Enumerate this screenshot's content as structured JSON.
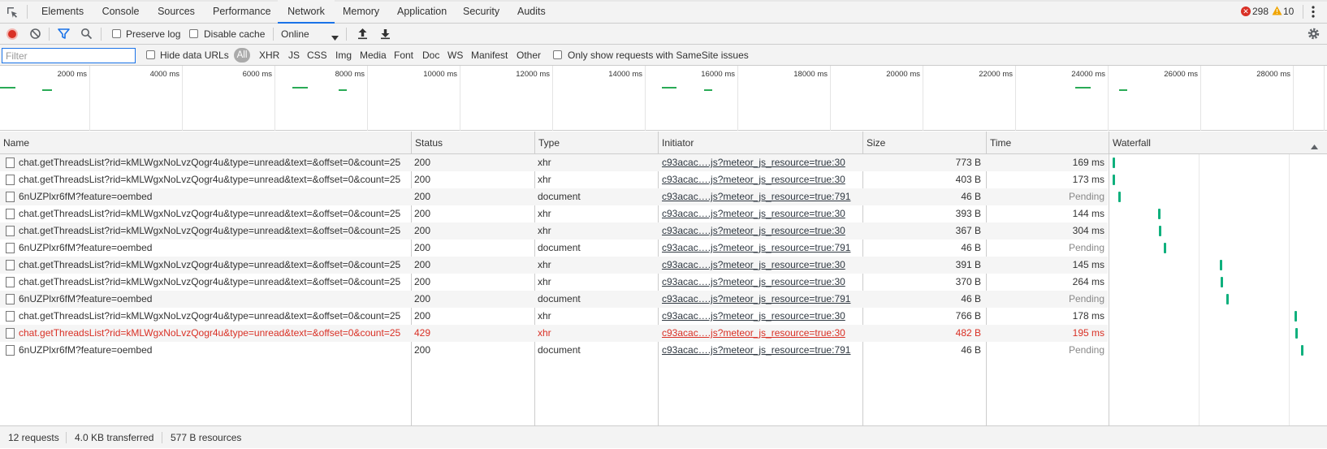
{
  "tabs": [
    {
      "label": "Elements",
      "active": false
    },
    {
      "label": "Console",
      "active": false
    },
    {
      "label": "Sources",
      "active": false
    },
    {
      "label": "Performance",
      "active": false
    },
    {
      "label": "Network",
      "active": true
    },
    {
      "label": "Memory",
      "active": false
    },
    {
      "label": "Application",
      "active": false
    },
    {
      "label": "Security",
      "active": false
    },
    {
      "label": "Audits",
      "active": false
    }
  ],
  "badges": {
    "errors": "298",
    "warnings": "10"
  },
  "icons": {
    "inspect": "inspect-element-icon",
    "device": "device-toolbar-icon",
    "record": "record-icon",
    "clear": "clear-icon",
    "filter": "filter-icon",
    "search": "search-icon",
    "upload": "import-har-icon",
    "download": "export-har-icon",
    "settings": "gear-icon",
    "more": "more-vertical-icon",
    "error": "error-icon",
    "warning": "warning-icon",
    "sort": "sort-ascending-icon",
    "file": "document-file-icon"
  },
  "toolbar": {
    "preserve_log": "Preserve log",
    "disable_cache": "Disable cache",
    "throttling": "Online"
  },
  "filter": {
    "placeholder": "Filter",
    "hide_data_urls": "Hide data URLs",
    "types": [
      "All",
      "XHR",
      "JS",
      "CSS",
      "Img",
      "Media",
      "Font",
      "Doc",
      "WS",
      "Manifest",
      "Other"
    ],
    "samesite": "Only show requests with SameSite issues"
  },
  "overview": {
    "ticks": [
      "2000 ms",
      "4000 ms",
      "6000 ms",
      "8000 ms",
      "10000 ms",
      "12000 ms",
      "14000 ms",
      "16000 ms",
      "18000 ms",
      "20000 ms",
      "22000 ms",
      "24000 ms",
      "26000 ms",
      "28000 ms"
    ]
  },
  "columns": {
    "name": "Name",
    "status": "Status",
    "type": "Type",
    "initiator": "Initiator",
    "size": "Size",
    "time": "Time",
    "waterfall": "Waterfall"
  },
  "requests": [
    {
      "name": "chat.getThreadsList?rid=kMLWgxNoLvzQogr4u&type=unread&text=&offset=0&count=25",
      "status": "200",
      "type": "xhr",
      "initiator": "c93acac….js?meteor_js_resource=true:30",
      "size": "773 B",
      "time": "169 ms",
      "wf_start_ms": 200,
      "error": false,
      "pending": false
    },
    {
      "name": "chat.getThreadsList?rid=kMLWgxNoLvzQogr4u&type=unread&text=&offset=0&count=25",
      "status": "200",
      "type": "xhr",
      "initiator": "c93acac….js?meteor_js_resource=true:30",
      "size": "403 B",
      "time": "173 ms",
      "wf_start_ms": 250,
      "error": false,
      "pending": false
    },
    {
      "name": "6nUZPlxr6fM?feature=oembed",
      "status": "200",
      "type": "document",
      "initiator": "c93acac….js?meteor_js_resource=true:791",
      "size": "46 B",
      "time": "Pending",
      "wf_start_ms": 1000,
      "error": false,
      "pending": true
    },
    {
      "name": "chat.getThreadsList?rid=kMLWgxNoLvzQogr4u&type=unread&text=&offset=0&count=25",
      "status": "200",
      "type": "xhr",
      "initiator": "c93acac….js?meteor_js_resource=true:30",
      "size": "393 B",
      "time": "144 ms",
      "wf_start_ms": 6300,
      "error": false,
      "pending": false
    },
    {
      "name": "chat.getThreadsList?rid=kMLWgxNoLvzQogr4u&type=unread&text=&offset=0&count=25",
      "status": "200",
      "type": "xhr",
      "initiator": "c93acac….js?meteor_js_resource=true:30",
      "size": "367 B",
      "time": "304 ms",
      "wf_start_ms": 6400,
      "error": false,
      "pending": false
    },
    {
      "name": "6nUZPlxr6fM?feature=oembed",
      "status": "200",
      "type": "document",
      "initiator": "c93acac….js?meteor_js_resource=true:791",
      "size": "46 B",
      "time": "Pending",
      "wf_start_ms": 7100,
      "error": false,
      "pending": true
    },
    {
      "name": "chat.getThreadsList?rid=kMLWgxNoLvzQogr4u&type=unread&text=&offset=0&count=25",
      "status": "200",
      "type": "xhr",
      "initiator": "c93acac….js?meteor_js_resource=true:30",
      "size": "391 B",
      "time": "145 ms",
      "wf_start_ms": 14600,
      "error": false,
      "pending": false
    },
    {
      "name": "chat.getThreadsList?rid=kMLWgxNoLvzQogr4u&type=unread&text=&offset=0&count=25",
      "status": "200",
      "type": "xhr",
      "initiator": "c93acac….js?meteor_js_resource=true:30",
      "size": "370 B",
      "time": "264 ms",
      "wf_start_ms": 14700,
      "error": false,
      "pending": false
    },
    {
      "name": "6nUZPlxr6fM?feature=oembed",
      "status": "200",
      "type": "document",
      "initiator": "c93acac….js?meteor_js_resource=true:791",
      "size": "46 B",
      "time": "Pending",
      "wf_start_ms": 15500,
      "error": false,
      "pending": true
    },
    {
      "name": "chat.getThreadsList?rid=kMLWgxNoLvzQogr4u&type=unread&text=&offset=0&count=25",
      "status": "200",
      "type": "xhr",
      "initiator": "c93acac….js?meteor_js_resource=true:30",
      "size": "766 B",
      "time": "178 ms",
      "wf_start_ms": 24600,
      "error": false,
      "pending": false
    },
    {
      "name": "chat.getThreadsList?rid=kMLWgxNoLvzQogr4u&type=unread&text=&offset=0&count=25",
      "status": "429",
      "type": "xhr",
      "initiator": "c93acac….js?meteor_js_resource=true:30",
      "size": "482 B",
      "time": "195 ms",
      "wf_start_ms": 24700,
      "error": true,
      "pending": false
    },
    {
      "name": "6nUZPlxr6fM?feature=oembed",
      "status": "200",
      "type": "document",
      "initiator": "c93acac….js?meteor_js_resource=true:791",
      "size": "46 B",
      "time": "Pending",
      "wf_start_ms": 25500,
      "error": false,
      "pending": true
    }
  ],
  "summary": {
    "requests": "12 requests",
    "transferred": "4.0 KB transferred",
    "resources": "577 B resources"
  },
  "colors": {
    "accent": "#1a73e8",
    "record": "#d93025",
    "error": "#d93025",
    "warning": "#f0a500",
    "waterfall": "#0fb07d"
  }
}
